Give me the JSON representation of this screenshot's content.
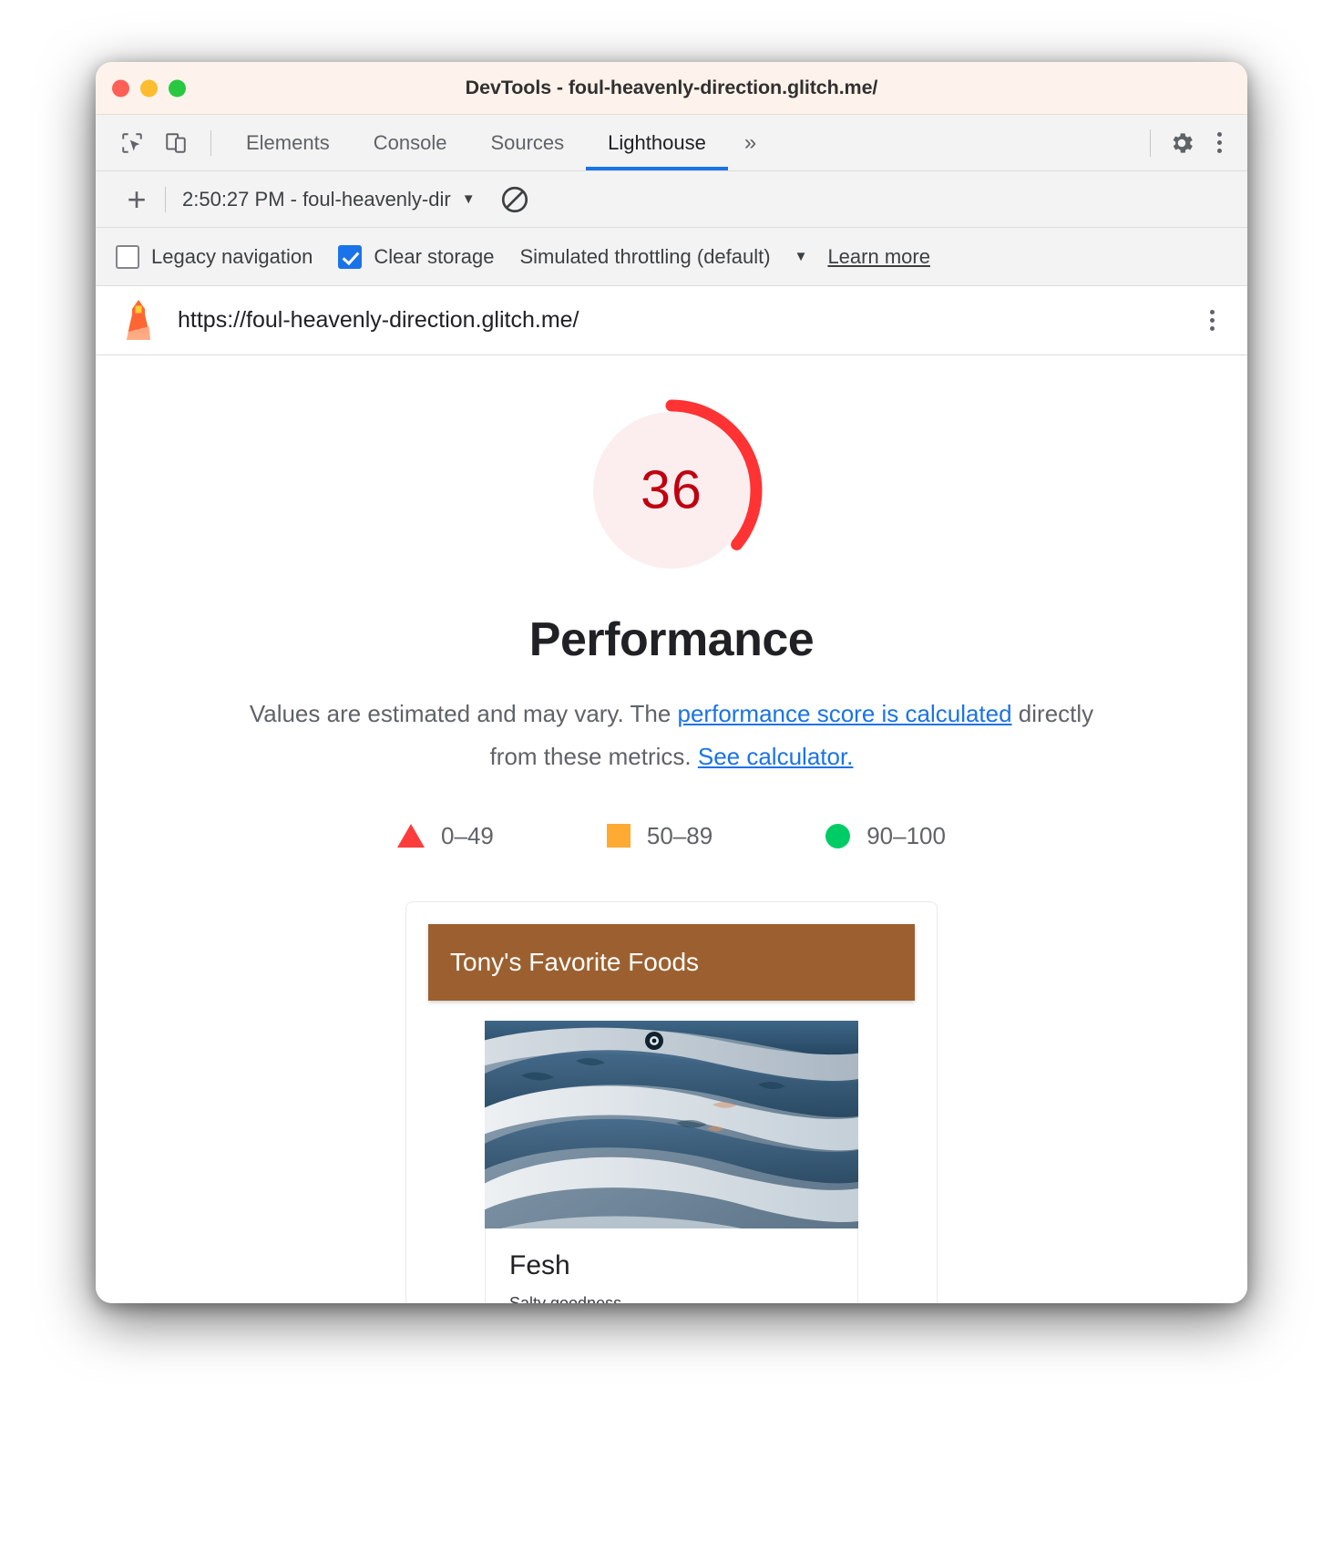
{
  "window": {
    "title": "DevTools - foul-heavenly-direction.glitch.me/",
    "traffic_lights": [
      "close-button",
      "minimize-button",
      "zoom-button"
    ]
  },
  "tabbar": {
    "inspect_icon": "inspect-element-icon",
    "device_icon": "device-toolbar-icon",
    "tabs": [
      {
        "label": "Elements",
        "active": false
      },
      {
        "label": "Console",
        "active": false
      },
      {
        "label": "Sources",
        "active": false
      },
      {
        "label": "Lighthouse",
        "active": true
      }
    ],
    "more_tabs": "»",
    "settings_icon": "gear-icon",
    "menu_icon": "kebab-menu-icon"
  },
  "runbar": {
    "add_label": "+",
    "run_selected": "2:50:27 PM - foul-heavenly-dir",
    "caret": "▼",
    "clear_icon": "clear-all-icon"
  },
  "options": {
    "legacy_navigation": {
      "label": "Legacy navigation",
      "checked": false
    },
    "clear_storage": {
      "label": "Clear storage",
      "checked": true
    },
    "throttling": {
      "label": "Simulated throttling (default)",
      "caret": "▼"
    },
    "learn_more": "Learn more"
  },
  "urlbar": {
    "lighthouse_icon": "lighthouse-icon",
    "url": "https://foul-heavenly-direction.glitch.me/",
    "menu_icon": "kebab-menu-icon"
  },
  "report": {
    "score": "36",
    "score_percent": 36,
    "score_color": "#c00011",
    "score_arc_color": "#f33",
    "score_track_color": "#fceeee",
    "category": "Performance",
    "disclaimer_pre": "Values are estimated and may vary. The ",
    "disclaimer_link1": "performance score is calculated",
    "disclaimer_mid": " directly from these metrics. ",
    "disclaimer_link2": "See calculator.",
    "legend": [
      {
        "shape": "triangle",
        "color": "#ff3c3c",
        "label": "0–49"
      },
      {
        "shape": "square",
        "color": "#ffaa33",
        "label": "50–89"
      },
      {
        "shape": "circle",
        "color": "#00cc66",
        "label": "90–100"
      }
    ]
  },
  "screenshot": {
    "banner_title": "Tony's Favorite Foods",
    "banner_color": "#9c6030",
    "photo_alt": "fish-photo",
    "item_title": "Fesh",
    "item_subtitle": "Salty goodness"
  }
}
